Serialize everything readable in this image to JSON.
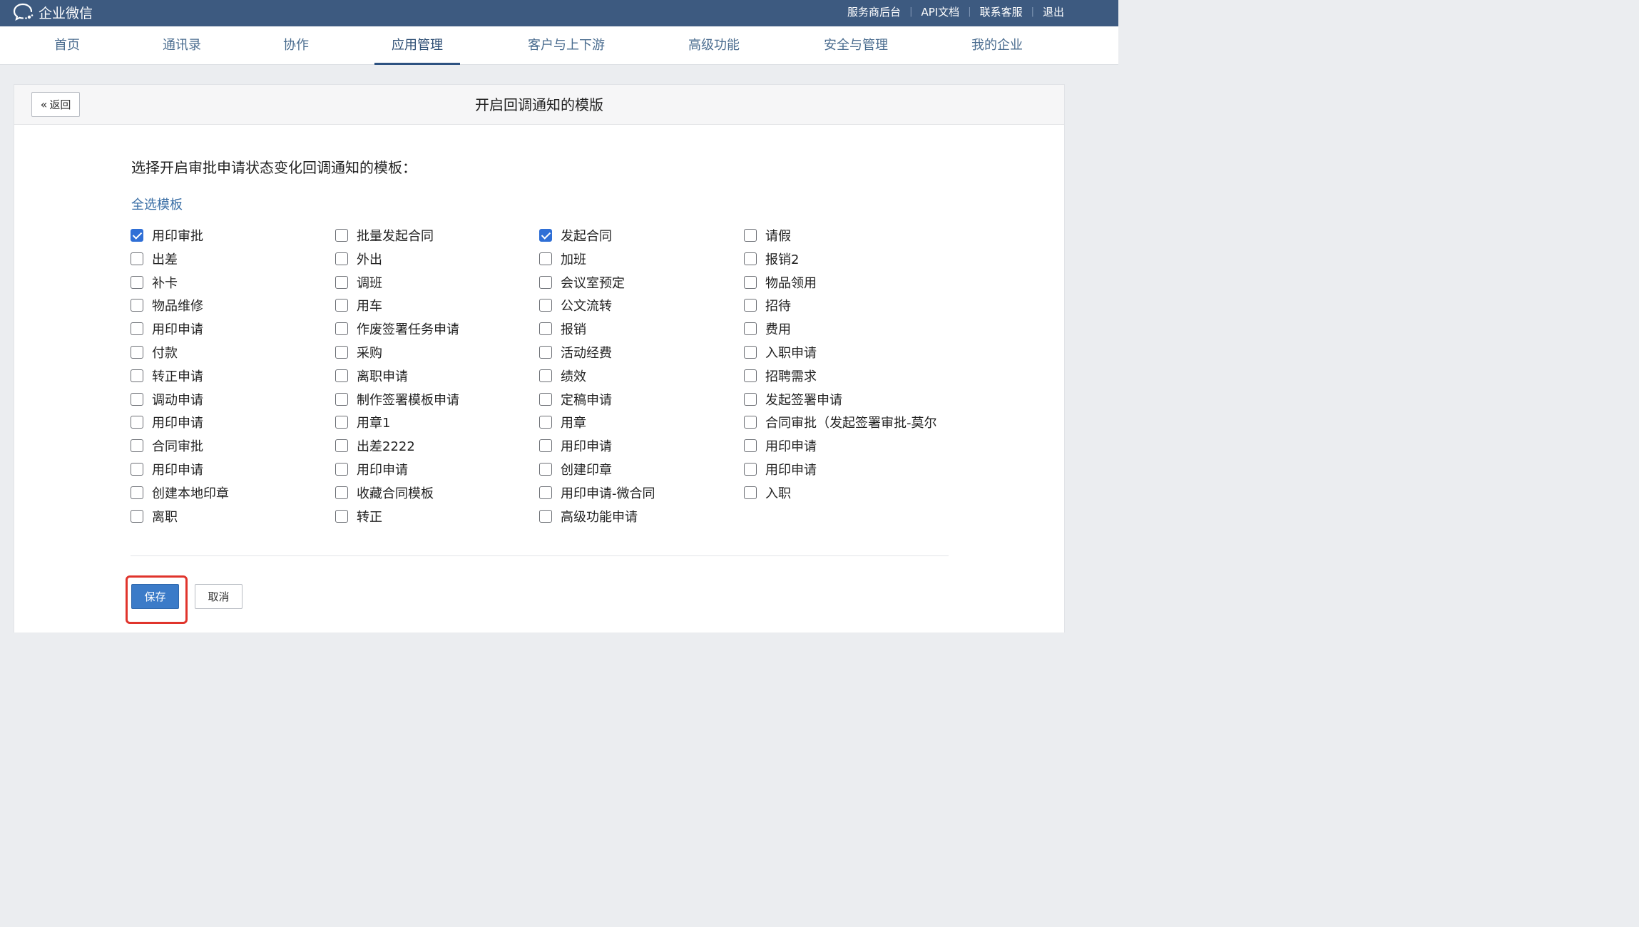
{
  "brand": {
    "name": "企业微信",
    "icon": "wecom-chat-icon"
  },
  "top_links": [
    "服务商后台",
    "API文档",
    "联系客服",
    "退出"
  ],
  "nav": {
    "items": [
      "首页",
      "通讯录",
      "协作",
      "应用管理",
      "客户与上下游",
      "高级功能",
      "安全与管理",
      "我的企业"
    ],
    "active": "应用管理"
  },
  "card": {
    "back_label": "返回",
    "title": "开启回调通知的模版",
    "prompt": "选择开启审批申请状态变化回调通知的模板：",
    "select_all": "全选模板",
    "columns": [
      [
        {
          "label": "用印审批",
          "checked": true
        },
        {
          "label": "出差",
          "checked": false
        },
        {
          "label": "补卡",
          "checked": false
        },
        {
          "label": "物品维修",
          "checked": false
        },
        {
          "label": "用印申请",
          "checked": false
        },
        {
          "label": "付款",
          "checked": false
        },
        {
          "label": "转正申请",
          "checked": false
        },
        {
          "label": "调动申请",
          "checked": false
        },
        {
          "label": "用印申请",
          "checked": false
        },
        {
          "label": "合同审批",
          "checked": false
        },
        {
          "label": "用印申请",
          "checked": false
        },
        {
          "label": "创建本地印章",
          "checked": false
        },
        {
          "label": "离职",
          "checked": false
        }
      ],
      [
        {
          "label": "批量发起合同",
          "checked": false
        },
        {
          "label": "外出",
          "checked": false
        },
        {
          "label": "调班",
          "checked": false
        },
        {
          "label": "用车",
          "checked": false
        },
        {
          "label": "作废签署任务申请",
          "checked": false
        },
        {
          "label": "采购",
          "checked": false
        },
        {
          "label": "离职申请",
          "checked": false
        },
        {
          "label": "制作签署模板申请",
          "checked": false
        },
        {
          "label": "用章1",
          "checked": false
        },
        {
          "label": "出差2222",
          "checked": false
        },
        {
          "label": "用印申请",
          "checked": false
        },
        {
          "label": "收藏合同模板",
          "checked": false
        },
        {
          "label": "转正",
          "checked": false
        }
      ],
      [
        {
          "label": "发起合同",
          "checked": true
        },
        {
          "label": "加班",
          "checked": false
        },
        {
          "label": "会议室预定",
          "checked": false
        },
        {
          "label": "公文流转",
          "checked": false
        },
        {
          "label": "报销",
          "checked": false
        },
        {
          "label": "活动经费",
          "checked": false
        },
        {
          "label": "绩效",
          "checked": false
        },
        {
          "label": "定稿申请",
          "checked": false
        },
        {
          "label": "用章",
          "checked": false
        },
        {
          "label": "用印申请",
          "checked": false
        },
        {
          "label": "创建印章",
          "checked": false
        },
        {
          "label": "用印申请-微合同",
          "checked": false
        },
        {
          "label": "高级功能申请",
          "checked": false
        }
      ],
      [
        {
          "label": "请假",
          "checked": false
        },
        {
          "label": "报销2",
          "checked": false
        },
        {
          "label": "物品领用",
          "checked": false
        },
        {
          "label": "招待",
          "checked": false
        },
        {
          "label": "费用",
          "checked": false
        },
        {
          "label": "入职申请",
          "checked": false
        },
        {
          "label": "招聘需求",
          "checked": false
        },
        {
          "label": "发起签署申请",
          "checked": false
        },
        {
          "label": "合同审批（发起签署审批-莫尔",
          "checked": false
        },
        {
          "label": "用印申请",
          "checked": false
        },
        {
          "label": "用印申请",
          "checked": false
        },
        {
          "label": "入职",
          "checked": false
        }
      ]
    ],
    "save_label": "保存",
    "cancel_label": "取消"
  },
  "colors": {
    "topbar": "#3d5a80",
    "accent": "#3b7bc8",
    "link": "#3a6ea5",
    "highlight": "#e0342c"
  }
}
